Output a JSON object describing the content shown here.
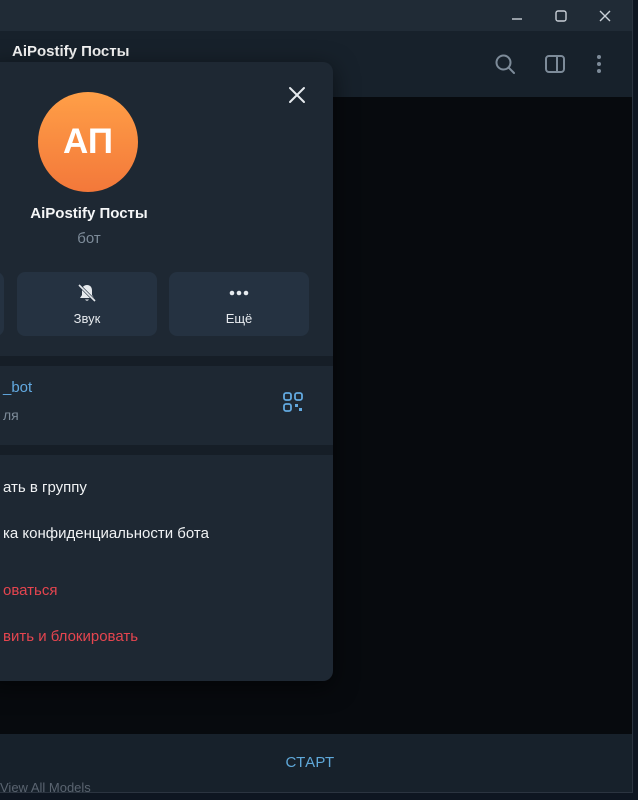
{
  "window": {
    "controls": [
      "minimize-icon",
      "maximize-icon",
      "close-icon"
    ]
  },
  "chat_header": {
    "title": "AiPostify Посты",
    "icons": [
      "search-icon",
      "sidebar-toggle-icon",
      "more-vertical-icon"
    ]
  },
  "profile": {
    "avatar_initials": "АП",
    "avatar_color": "#f7893f",
    "name": "AiPostify Посты",
    "status": "бот",
    "actions": [
      {
        "label": "Звук",
        "icon": "bell-off-icon"
      },
      {
        "label": "Ещё",
        "icon": "more-horizontal-icon"
      }
    ],
    "username": "_bot",
    "username_caption": "ля",
    "menu": [
      {
        "label": "ать в группу"
      },
      {
        "label": "ка конфиденциальности бота"
      },
      {
        "label": "оваться"
      },
      {
        "label": "вить и блокировать"
      }
    ]
  },
  "bottom_bar": {
    "start_label": "СТАРТ",
    "underlay_text": "View All Models"
  },
  "colors": {
    "accent": "#5fa8d9",
    "danger": "#e5454f",
    "panel_bg": "#1e2833"
  }
}
